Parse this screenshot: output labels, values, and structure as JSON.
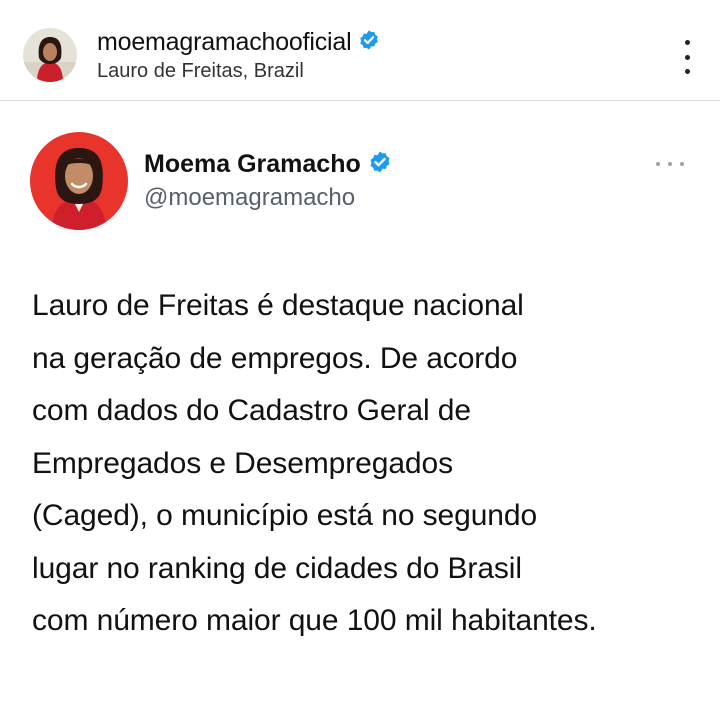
{
  "post_header": {
    "username": "moemagramachooficial",
    "location": "Lauro de Freitas, Brazil",
    "verified_icon": "verified-badge-icon",
    "menu_icon": "more-vertical-icon"
  },
  "tweet": {
    "display_name": "Moema Gramacho",
    "handle": "@moemagramacho",
    "verified_icon": "verified-badge-icon",
    "menu_icon": "more-horizontal-icon",
    "lines": [
      "Lauro de Freitas é destaque nacional",
      "na geração de empregos. De acordo",
      "com dados do Cadastro Geral de",
      "Empregados e Desempregados",
      "(Caged), o município está no segundo",
      "lugar no ranking de cidades do Brasil",
      "com número maior que 100 mil habitantes."
    ]
  },
  "colors": {
    "verified": "#1d9bf0",
    "avatar_background": "#e8342b",
    "handle": "#55606b"
  }
}
